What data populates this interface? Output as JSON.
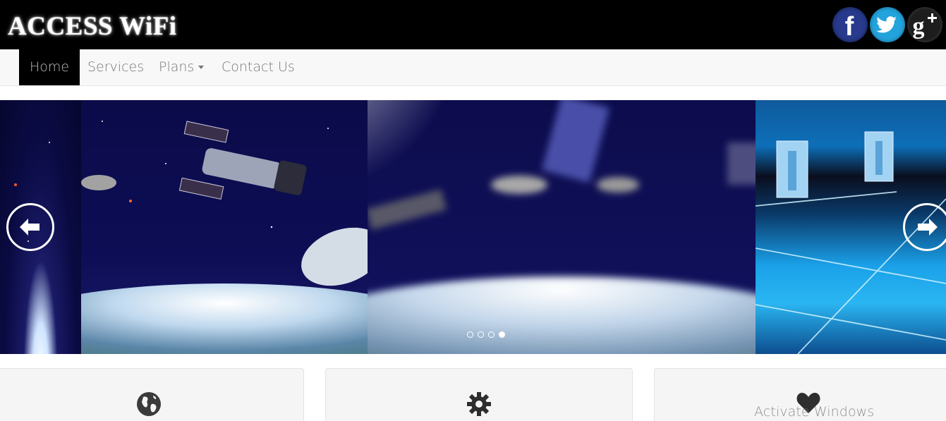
{
  "header": {
    "brand": "ACCESS WiFi",
    "social": [
      {
        "name": "facebook",
        "icon": "facebook-icon",
        "color": "#273a8c"
      },
      {
        "name": "twitter",
        "icon": "twitter-icon",
        "color": "#23a3dc"
      },
      {
        "name": "google-plus",
        "icon": "google-plus-icon",
        "color": "#1d1d1d"
      }
    ]
  },
  "nav": {
    "items": [
      {
        "label": "Home",
        "active": true
      },
      {
        "label": "Services"
      },
      {
        "label": "Plans",
        "dropdown": true
      },
      {
        "label": "Contact Us"
      }
    ]
  },
  "carousel": {
    "prev_icon": "arrow-left-icon",
    "next_icon": "arrow-right-icon",
    "slide_count": 4,
    "active_index": 3
  },
  "features": [
    {
      "icon": "globe-icon"
    },
    {
      "icon": "gear-icon"
    },
    {
      "icon": "heart-icon"
    }
  ],
  "watermark": "Activate Windows",
  "colors": {
    "header_bg": "#000000",
    "navbar_bg": "#f8f8f8",
    "nav_active_bg": "#000000",
    "nav_text": "#777777"
  }
}
